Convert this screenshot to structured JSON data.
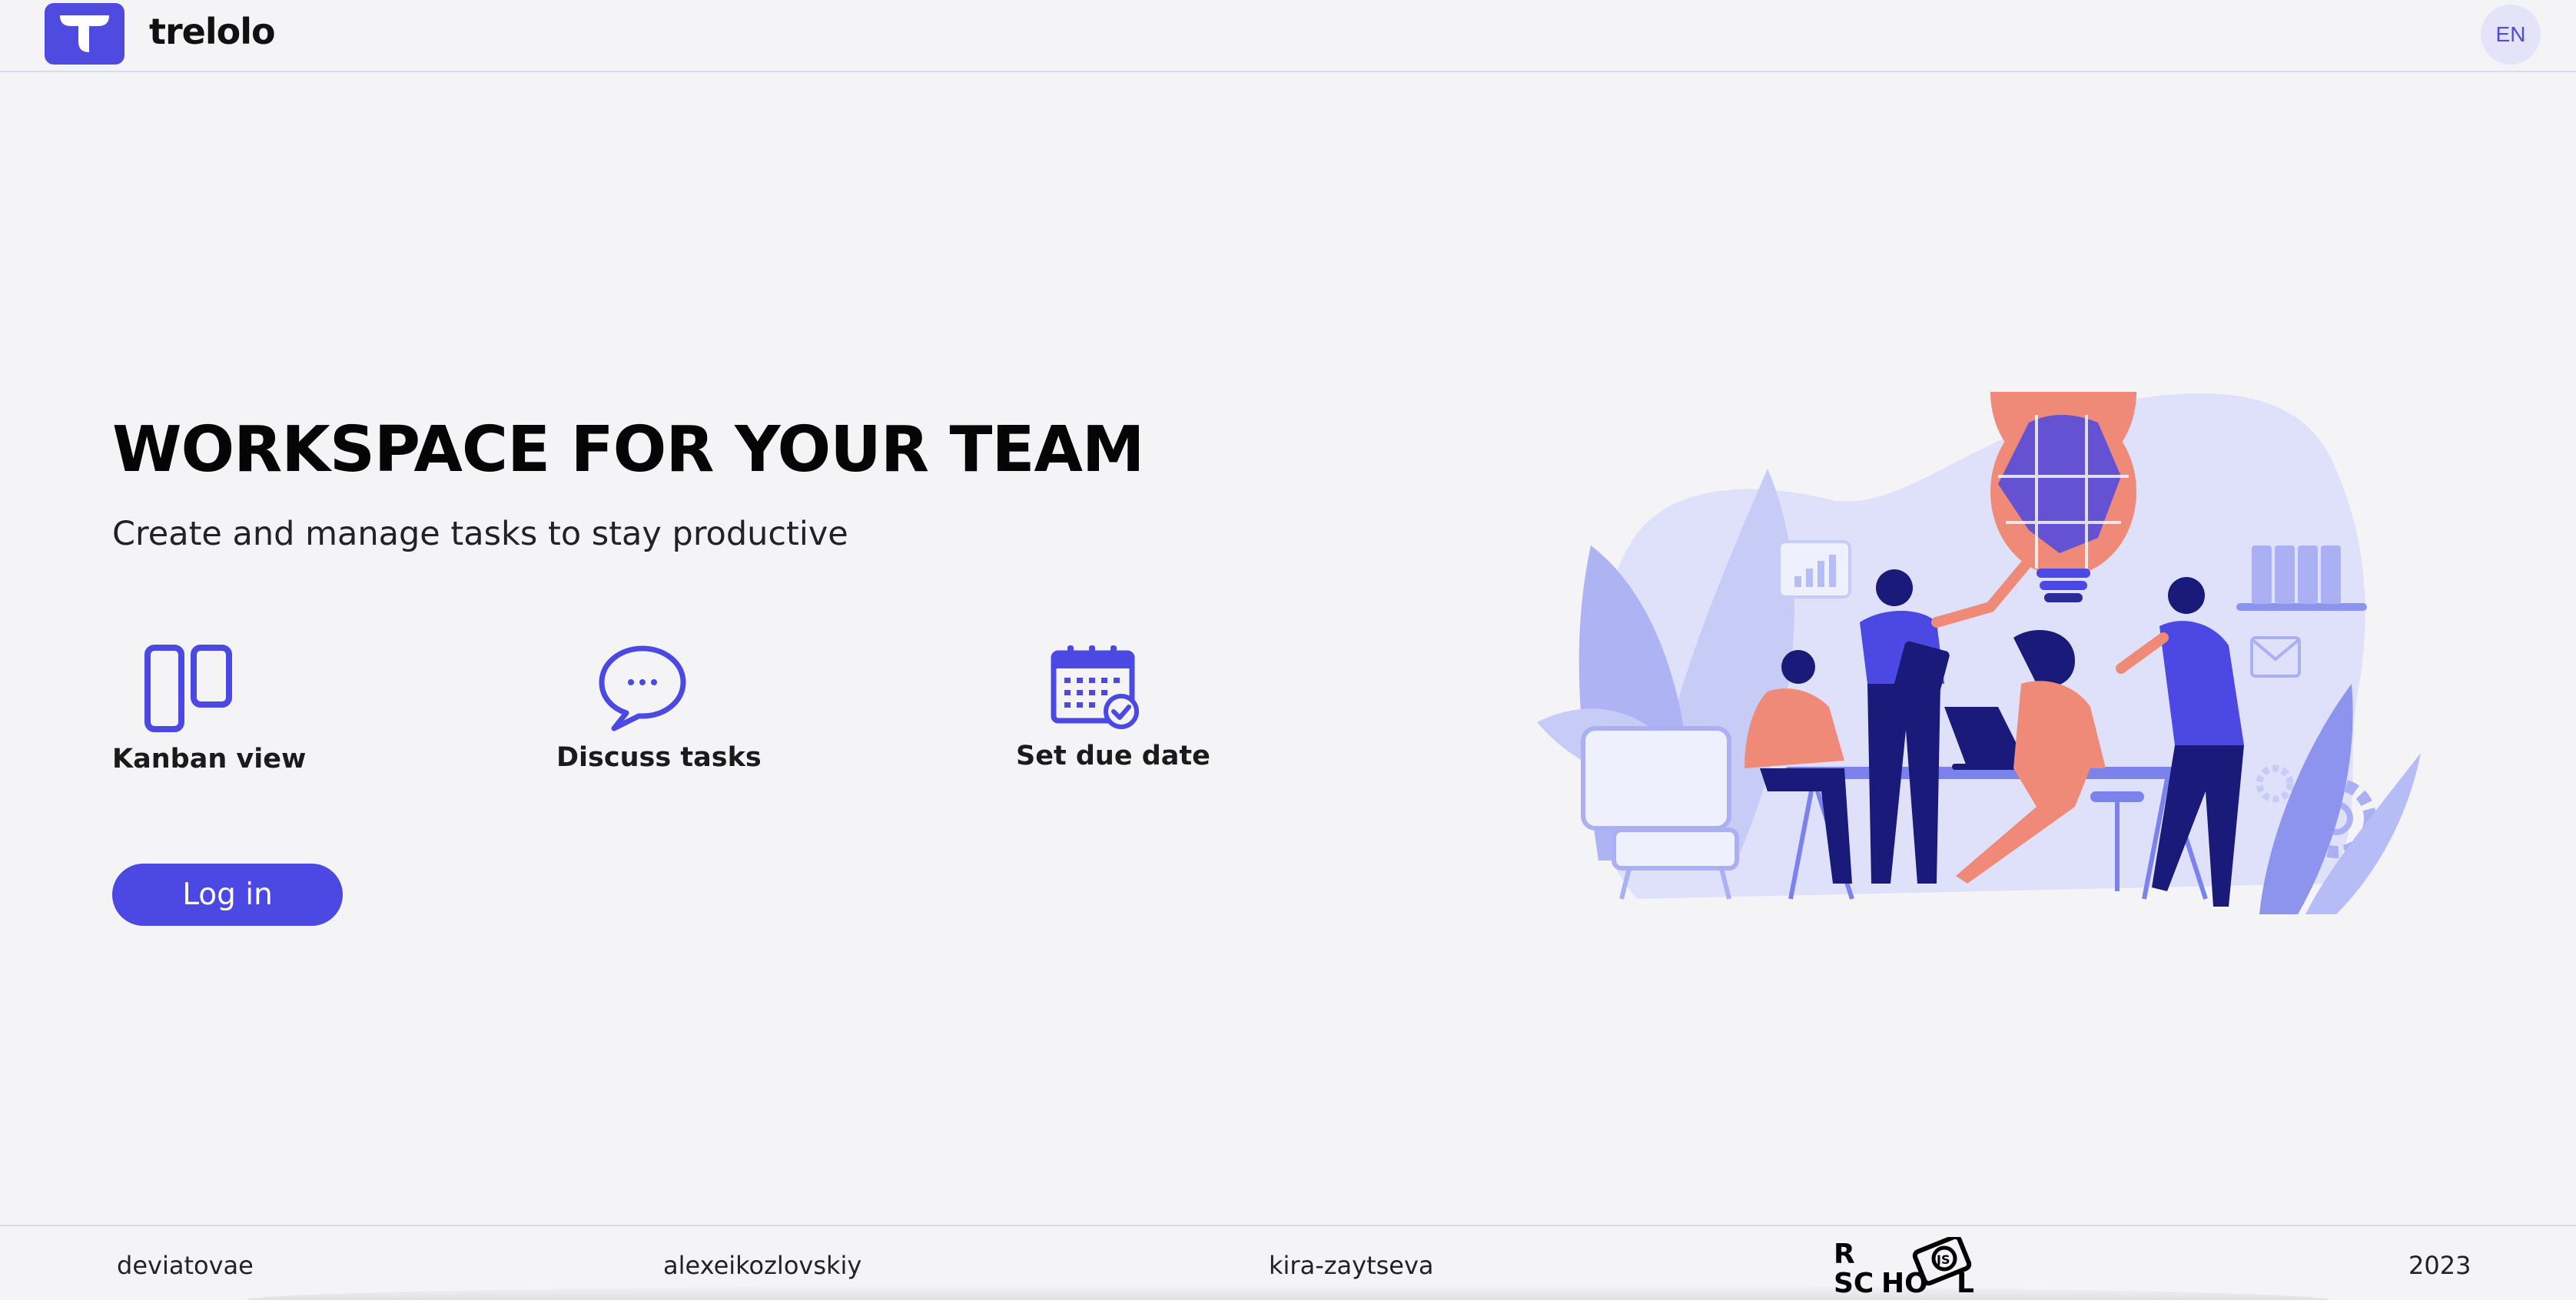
{
  "header": {
    "brand": "trelolo",
    "language": "EN"
  },
  "hero": {
    "title": "WORKSPACE FOR YOUR TEAM",
    "subtitle": "Create and manage tasks to stay productive",
    "features": [
      {
        "label": "Kanban view",
        "icon": "kanban-icon"
      },
      {
        "label": "Discuss tasks",
        "icon": "chat-bubble-icon"
      },
      {
        "label": "Set due date",
        "icon": "calendar-check-icon"
      }
    ],
    "login_label": "Log in"
  },
  "footer": {
    "authors": [
      "deviatovae",
      "alexeikozlovskiy",
      "kira-zaytseva"
    ],
    "school_logo": "RS SCHOOL JS",
    "year": "2023"
  },
  "colors": {
    "accent": "#4b48e3",
    "background": "#f4f4f7",
    "illustration_light": "#d9dcfa",
    "illustration_salmon": "#ef8a78",
    "illustration_navy": "#1a1a7a"
  }
}
